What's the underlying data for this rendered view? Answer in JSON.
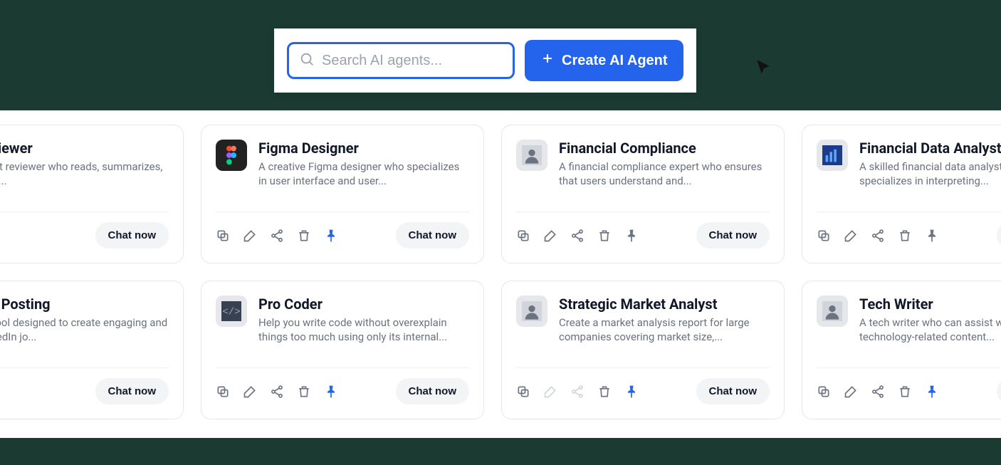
{
  "search": {
    "placeholder": "Search AI agents..."
  },
  "create_button": "Create AI Agent",
  "chat_label": "Chat now",
  "agents": [
    {
      "title": "Contract Reviewer",
      "desc": "An expert contract reviewer who reads, summarizes, and clarifies legal...",
      "icons": [
        "trash",
        "pin"
      ],
      "pin_active": false,
      "partial": "left"
    },
    {
      "title": "Figma Designer",
      "desc": "A creative Figma designer who specializes in user interface and user...",
      "icons": [
        "copy",
        "edit",
        "share",
        "trash",
        "pin"
      ],
      "pin_active": true,
      "avatar": "figma"
    },
    {
      "title": "Financial Compliance",
      "desc": "A financial compliance expert who ensures that users understand and...",
      "icons": [
        "copy",
        "edit",
        "share",
        "trash",
        "pin"
      ],
      "pin_active": false,
      "avatar": "person1"
    },
    {
      "title": "Financial Data Analyst",
      "desc": "A skilled financial data analyst who specializes in interpreting...",
      "icons": [
        "copy",
        "edit",
        "share",
        "trash",
        "pin"
      ],
      "pin_active": false,
      "avatar": "chart",
      "partial": "right"
    },
    {
      "title": "LinkedIn Job Posting",
      "desc": "An advanced AI tool designed to create engaging and professional LinkedIn jo...",
      "icons": [
        "trash",
        "pin"
      ],
      "pin_active": true,
      "partial": "left"
    },
    {
      "title": "Pro Coder",
      "desc": "Help you write code without overexplain things too much using only its internal...",
      "icons": [
        "copy",
        "edit",
        "share",
        "trash",
        "pin"
      ],
      "pin_active": true,
      "avatar": "code"
    },
    {
      "title": "Strategic Market Analyst",
      "desc": "Create a market analysis report for large companies covering market size,...",
      "icons": [
        "copy",
        "edit",
        "share",
        "trash",
        "pin"
      ],
      "pin_active": true,
      "avatar": "person2",
      "edit_share_disabled": true
    },
    {
      "title": "Tech Writer",
      "desc": "A tech writer who can assist with your technology-related content...",
      "icons": [
        "copy",
        "edit",
        "share",
        "trash",
        "pin"
      ],
      "pin_active": true,
      "avatar": "person3",
      "partial": "right"
    }
  ]
}
